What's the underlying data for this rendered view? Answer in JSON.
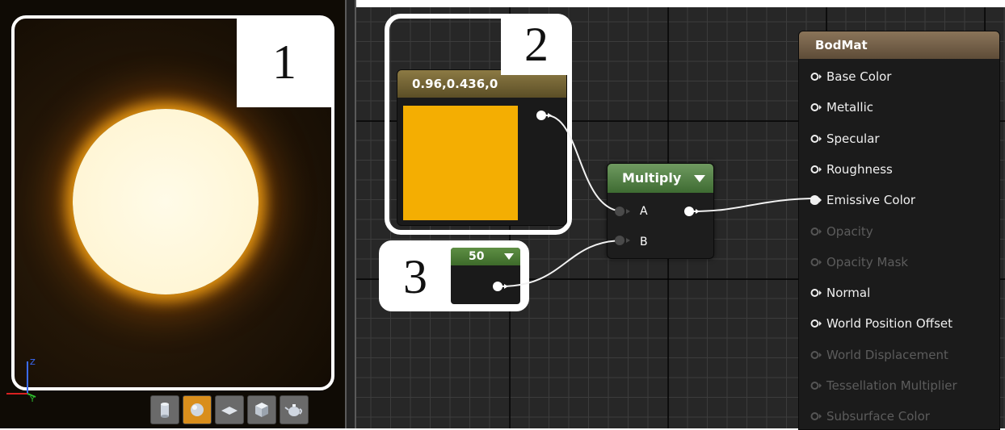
{
  "preview": {
    "callout": "1",
    "axis": {
      "z": "Z",
      "y": "Y"
    },
    "toolbar": [
      {
        "icon": "cylinder-icon",
        "active": false
      },
      {
        "icon": "sphere-icon",
        "active": true
      },
      {
        "icon": "plane-icon",
        "active": false
      },
      {
        "icon": "cube-icon",
        "active": false
      },
      {
        "icon": "teapot-icon",
        "active": false
      }
    ]
  },
  "graph": {
    "color_node": {
      "callout": "2",
      "title": "0.96,0.436,0",
      "color": "#f4ae02"
    },
    "constant_node": {
      "callout": "3",
      "title": "50"
    },
    "multiply_node": {
      "title": "Multiply",
      "pin_a": "A",
      "pin_b": "B"
    },
    "material_node": {
      "title": "BodMat",
      "inputs": [
        {
          "label": "Base Color",
          "enabled": true
        },
        {
          "label": "Metallic",
          "enabled": true
        },
        {
          "label": "Specular",
          "enabled": true
        },
        {
          "label": "Roughness",
          "enabled": true
        },
        {
          "label": "Emissive Color",
          "enabled": true,
          "connected": true
        },
        {
          "label": "Opacity",
          "enabled": false
        },
        {
          "label": "Opacity Mask",
          "enabled": false
        },
        {
          "label": "Normal",
          "enabled": true
        },
        {
          "label": "World Position Offset",
          "enabled": true
        },
        {
          "label": "World Displacement",
          "enabled": false
        },
        {
          "label": "Tessellation Multiplier",
          "enabled": false
        },
        {
          "label": "Subsurface Color",
          "enabled": false
        }
      ]
    }
  },
  "colors": {
    "glow": "#ffcf3a",
    "accent": "#d98e1c"
  }
}
